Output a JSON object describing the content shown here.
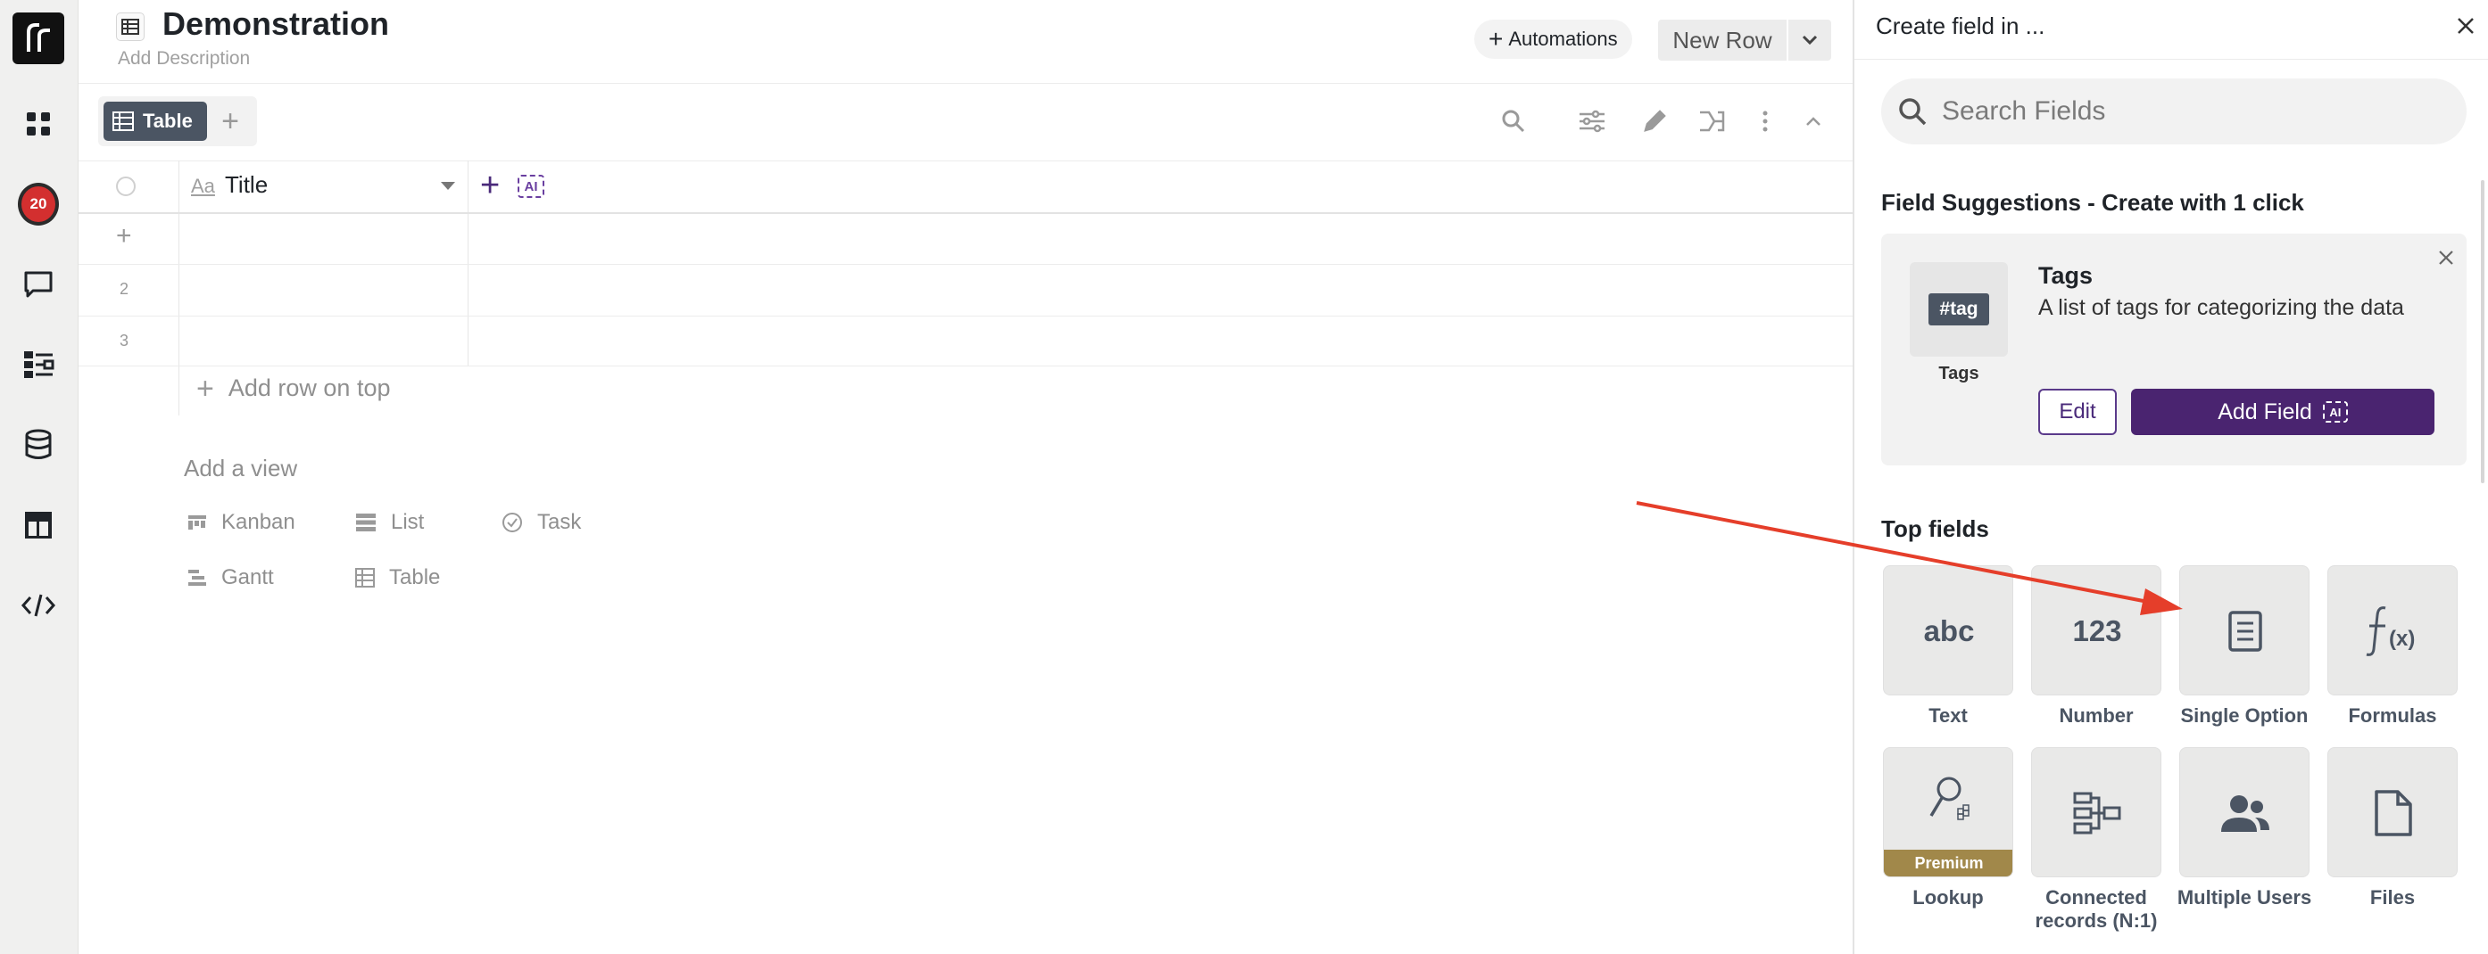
{
  "rail": {
    "badge_count": "20",
    "items": [
      "dashboard-icon",
      "notifications-badge",
      "chat-icon",
      "workflow-icon",
      "database-icon",
      "layout-icon",
      "code-icon"
    ]
  },
  "header": {
    "title": "Demonstration",
    "description_placeholder": "Add Description",
    "automations_label": "Automations",
    "new_row_label": "New Row"
  },
  "views": {
    "active_tab": "Table"
  },
  "grid": {
    "column_type_label": "Aa",
    "column_title": "Title",
    "ai_label": "AI",
    "row_numbers": [
      "2",
      "3"
    ],
    "add_row_label": "Add row on top"
  },
  "add_view": {
    "heading": "Add a view",
    "options": [
      "Kanban",
      "List",
      "Task",
      "Gantt",
      "Table"
    ]
  },
  "panel": {
    "title": "Create field in ...",
    "search_placeholder": "Search Fields",
    "suggestions_heading": "Field Suggestions - Create with 1 click",
    "suggestion": {
      "chip": "#tag",
      "tile_label": "Tags",
      "name": "Tags",
      "description": "A list of tags for categorizing the data",
      "edit_label": "Edit",
      "add_label": "Add Field",
      "ai_label": "AI"
    },
    "top_fields_heading": "Top fields",
    "top_fields": [
      {
        "label": "Text",
        "glyph": "abc"
      },
      {
        "label": "Number",
        "glyph": "123"
      },
      {
        "label": "Single Option",
        "glyph": "single-option-icon"
      },
      {
        "label": "Formulas",
        "glyph": "formula-icon"
      },
      {
        "label": "Lookup",
        "glyph": "lookup-icon",
        "badge": "Premium"
      },
      {
        "label": "Connected records (N:1)",
        "glyph": "connected-records-icon"
      },
      {
        "label": "Multiple Users",
        "glyph": "users-icon"
      },
      {
        "label": "Files",
        "glyph": "file-icon"
      }
    ]
  },
  "colors": {
    "accent": "#4a2470",
    "annotation_arrow": "#e53e2a",
    "badge": "#d32f2f",
    "active_tab": "#4b5563",
    "premium": "#a1884a"
  }
}
